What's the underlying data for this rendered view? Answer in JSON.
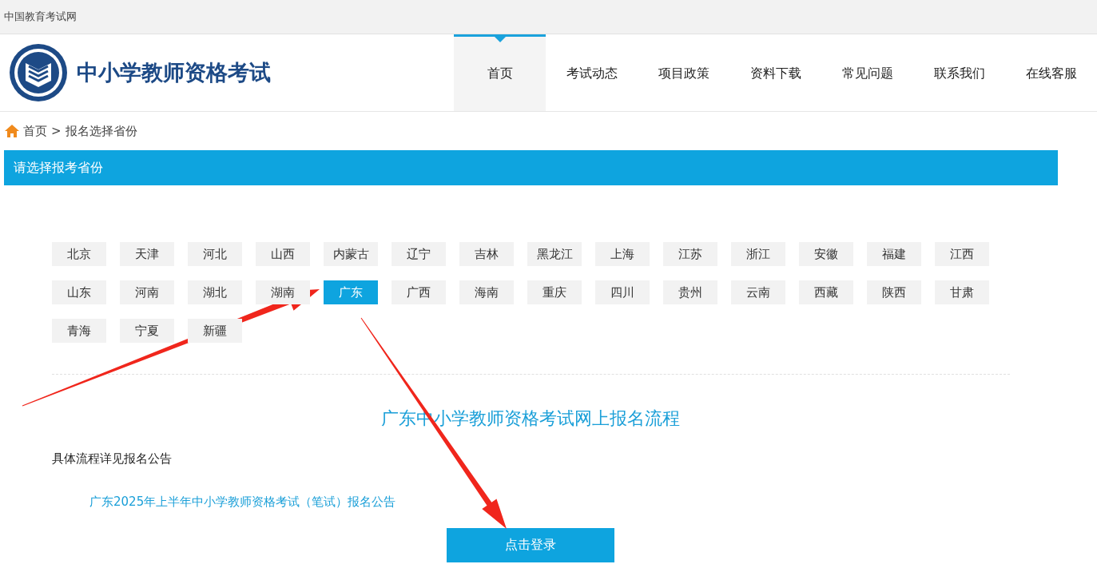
{
  "top_bar": {
    "title": "中国教育考试网"
  },
  "header": {
    "site_title": "中小学教师资格考试",
    "nav": [
      {
        "label": "首页",
        "selected": true
      },
      {
        "label": "考试动态",
        "selected": false
      },
      {
        "label": "项目政策",
        "selected": false
      },
      {
        "label": "资料下载",
        "selected": false
      },
      {
        "label": "常见问题",
        "selected": false
      },
      {
        "label": "联系我们",
        "selected": false
      },
      {
        "label": "在线客服",
        "selected": false
      }
    ]
  },
  "breadcrumb": {
    "home": "首页",
    "separator": ">",
    "current": "报名选择省份"
  },
  "section_heading": "请选择报考省份",
  "provinces": [
    {
      "label": "北京",
      "selected": false
    },
    {
      "label": "天津",
      "selected": false
    },
    {
      "label": "河北",
      "selected": false
    },
    {
      "label": "山西",
      "selected": false
    },
    {
      "label": "内蒙古",
      "selected": false
    },
    {
      "label": "辽宁",
      "selected": false
    },
    {
      "label": "吉林",
      "selected": false
    },
    {
      "label": "黑龙江",
      "selected": false
    },
    {
      "label": "上海",
      "selected": false
    },
    {
      "label": "江苏",
      "selected": false
    },
    {
      "label": "浙江",
      "selected": false
    },
    {
      "label": "安徽",
      "selected": false
    },
    {
      "label": "福建",
      "selected": false
    },
    {
      "label": "江西",
      "selected": false
    },
    {
      "label": "山东",
      "selected": false
    },
    {
      "label": "河南",
      "selected": false
    },
    {
      "label": "湖北",
      "selected": false
    },
    {
      "label": "湖南",
      "selected": false
    },
    {
      "label": "广东",
      "selected": true
    },
    {
      "label": "广西",
      "selected": false
    },
    {
      "label": "海南",
      "selected": false
    },
    {
      "label": "重庆",
      "selected": false
    },
    {
      "label": "四川",
      "selected": false
    },
    {
      "label": "贵州",
      "selected": false
    },
    {
      "label": "云南",
      "selected": false
    },
    {
      "label": "西藏",
      "selected": false
    },
    {
      "label": "陕西",
      "selected": false
    },
    {
      "label": "甘肃",
      "selected": false
    },
    {
      "label": "青海",
      "selected": false
    },
    {
      "label": "宁夏",
      "selected": false
    },
    {
      "label": "新疆",
      "selected": false
    }
  ],
  "process": {
    "title": "广东中小学教师资格考试网上报名流程",
    "note": "具体流程详见报名公告",
    "link": "广东2025年上半年中小学教师资格考试（笔试）报名公告",
    "button": "点击登录"
  }
}
